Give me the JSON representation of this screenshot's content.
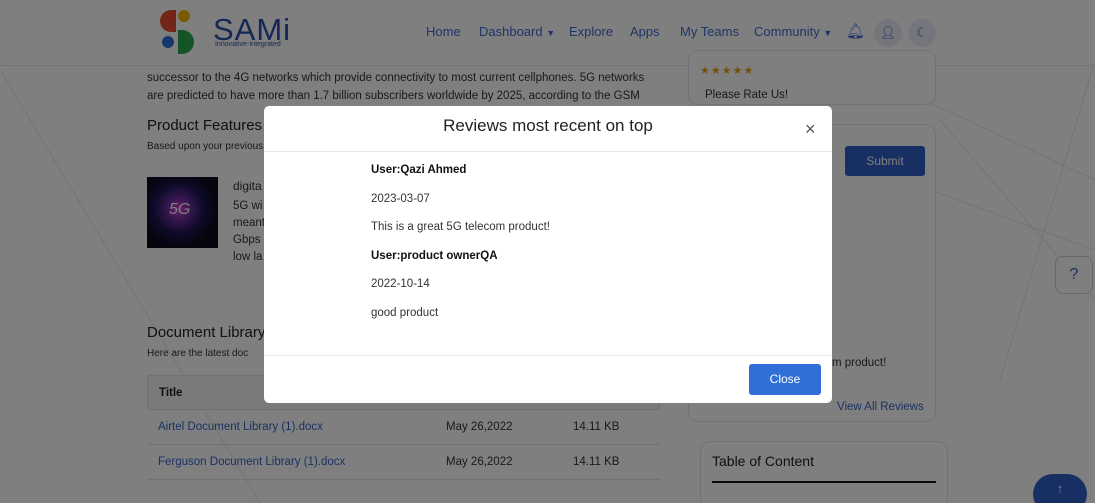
{
  "nav": {
    "brand": "SAMi",
    "tagline": "Innovative-Integrated",
    "items": [
      "Home",
      "Dashboard",
      "Explore",
      "Apps",
      "My Teams",
      "Community"
    ]
  },
  "page": {
    "intro_line1": "successor to the 4G networks which provide connectivity to most current cellphones. 5G networks",
    "intro_line2": "are predicted to have more than 1.7 billion subscribers worldwide by 2025, according to the GSM",
    "features_title": "Product Features",
    "features_sub": "Based upon your previous",
    "feature_heading": "digita",
    "feature_l1": "5G wi",
    "feature_l2": "meant",
    "feature_l3": "Gbps",
    "feature_l4": "low la",
    "doc_title": "Document Library",
    "doc_sub": "Here are the latest doc",
    "table_headers": [
      "Title",
      "",
      ""
    ],
    "docs": [
      {
        "title": "Airtel Document Library (1).docx",
        "date": "May 26,2022",
        "size": "14.11 KB"
      },
      {
        "title": "Ferguson Document Library (1).docx",
        "date": "May 26,2022",
        "size": "14.11 KB"
      }
    ],
    "stars": "★★★★★",
    "rate_us": "Please Rate Us!",
    "submit": "Submit",
    "review_snippet": "m product!",
    "view_all": "View All Reviews",
    "toc_title": "Table of Content"
  },
  "modal": {
    "title": "Reviews most recent on top",
    "close_x": "×",
    "reviews": [
      {
        "user": "User:Qazi Ahmed",
        "date": "2023-03-07",
        "text": "This is a great 5G telecom product!"
      },
      {
        "user": "User:product ownerQA",
        "date": "2022-10-14",
        "text": "good product"
      }
    ],
    "close_label": "Close"
  }
}
